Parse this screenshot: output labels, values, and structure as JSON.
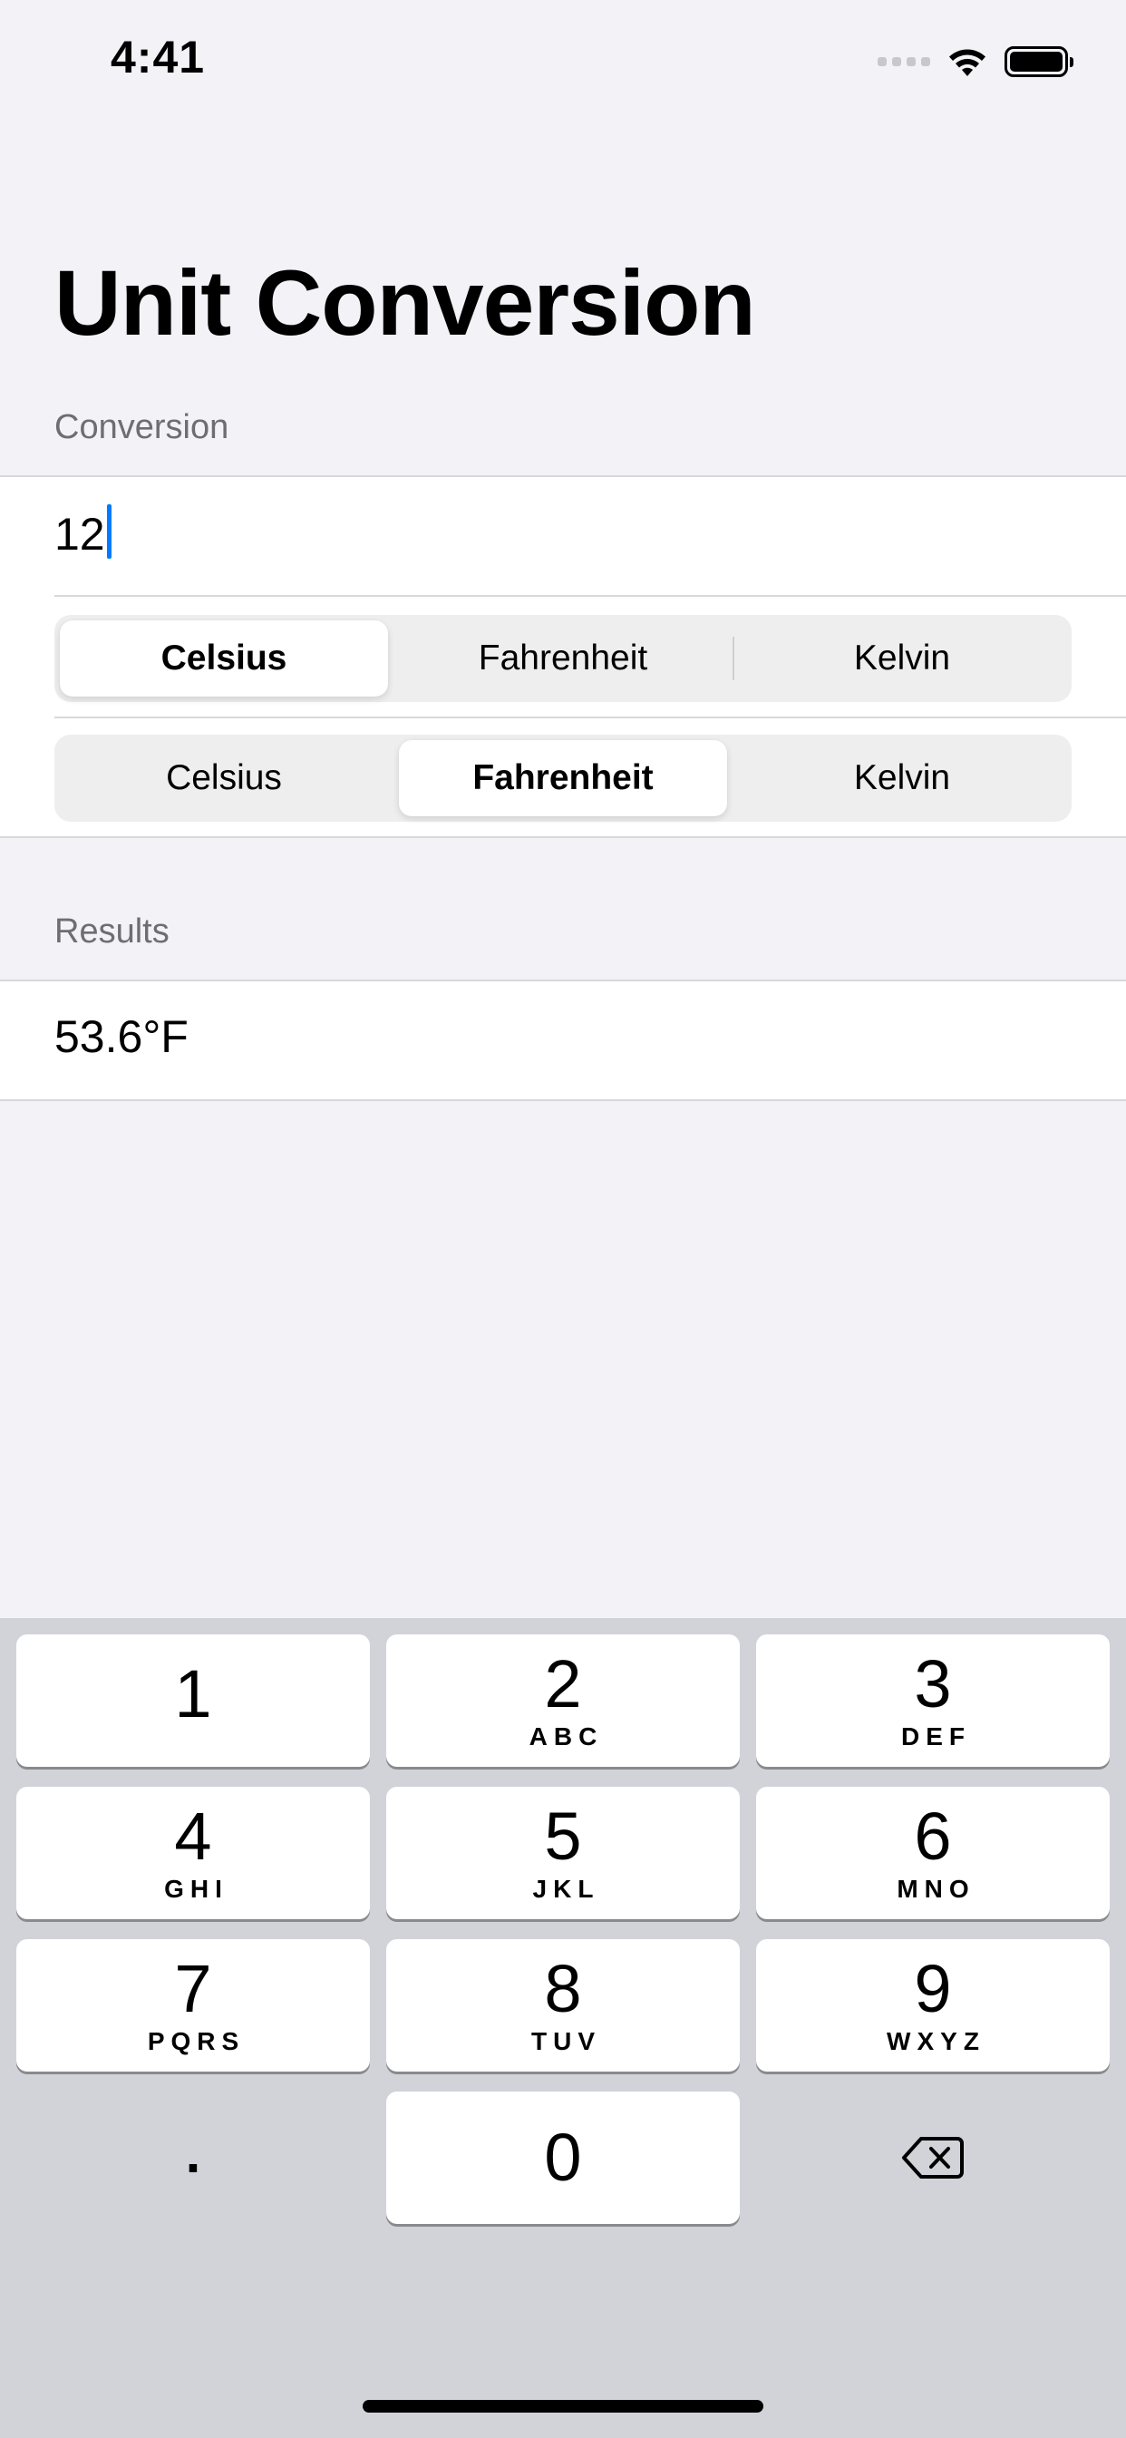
{
  "status_bar": {
    "time": "4:41"
  },
  "title": "Unit Conversion",
  "conversion_section": {
    "header": "Conversion",
    "input_value": "12",
    "from_units": {
      "options": [
        "Celsius",
        "Fahrenheit",
        "Kelvin"
      ],
      "selected": "Celsius"
    },
    "to_units": {
      "options": [
        "Celsius",
        "Fahrenheit",
        "Kelvin"
      ],
      "selected": "Fahrenheit"
    }
  },
  "results_section": {
    "header": "Results",
    "value": "53.6°F"
  },
  "keypad": {
    "keys": [
      {
        "digit": "1",
        "letters": ""
      },
      {
        "digit": "2",
        "letters": "ABC"
      },
      {
        "digit": "3",
        "letters": "DEF"
      },
      {
        "digit": "4",
        "letters": "GHI"
      },
      {
        "digit": "5",
        "letters": "JKL"
      },
      {
        "digit": "6",
        "letters": "MNO"
      },
      {
        "digit": "7",
        "letters": "PQRS"
      },
      {
        "digit": "8",
        "letters": "TUV"
      },
      {
        "digit": "9",
        "letters": "WXYZ"
      },
      {
        "digit": "0",
        "letters": ""
      }
    ],
    "decimal_label": ".",
    "delete_icon": "delete-backward-icon"
  },
  "colors": {
    "background": "#f2f2f7",
    "accent": "#007aff",
    "keyboard": "#d1d3d9"
  }
}
